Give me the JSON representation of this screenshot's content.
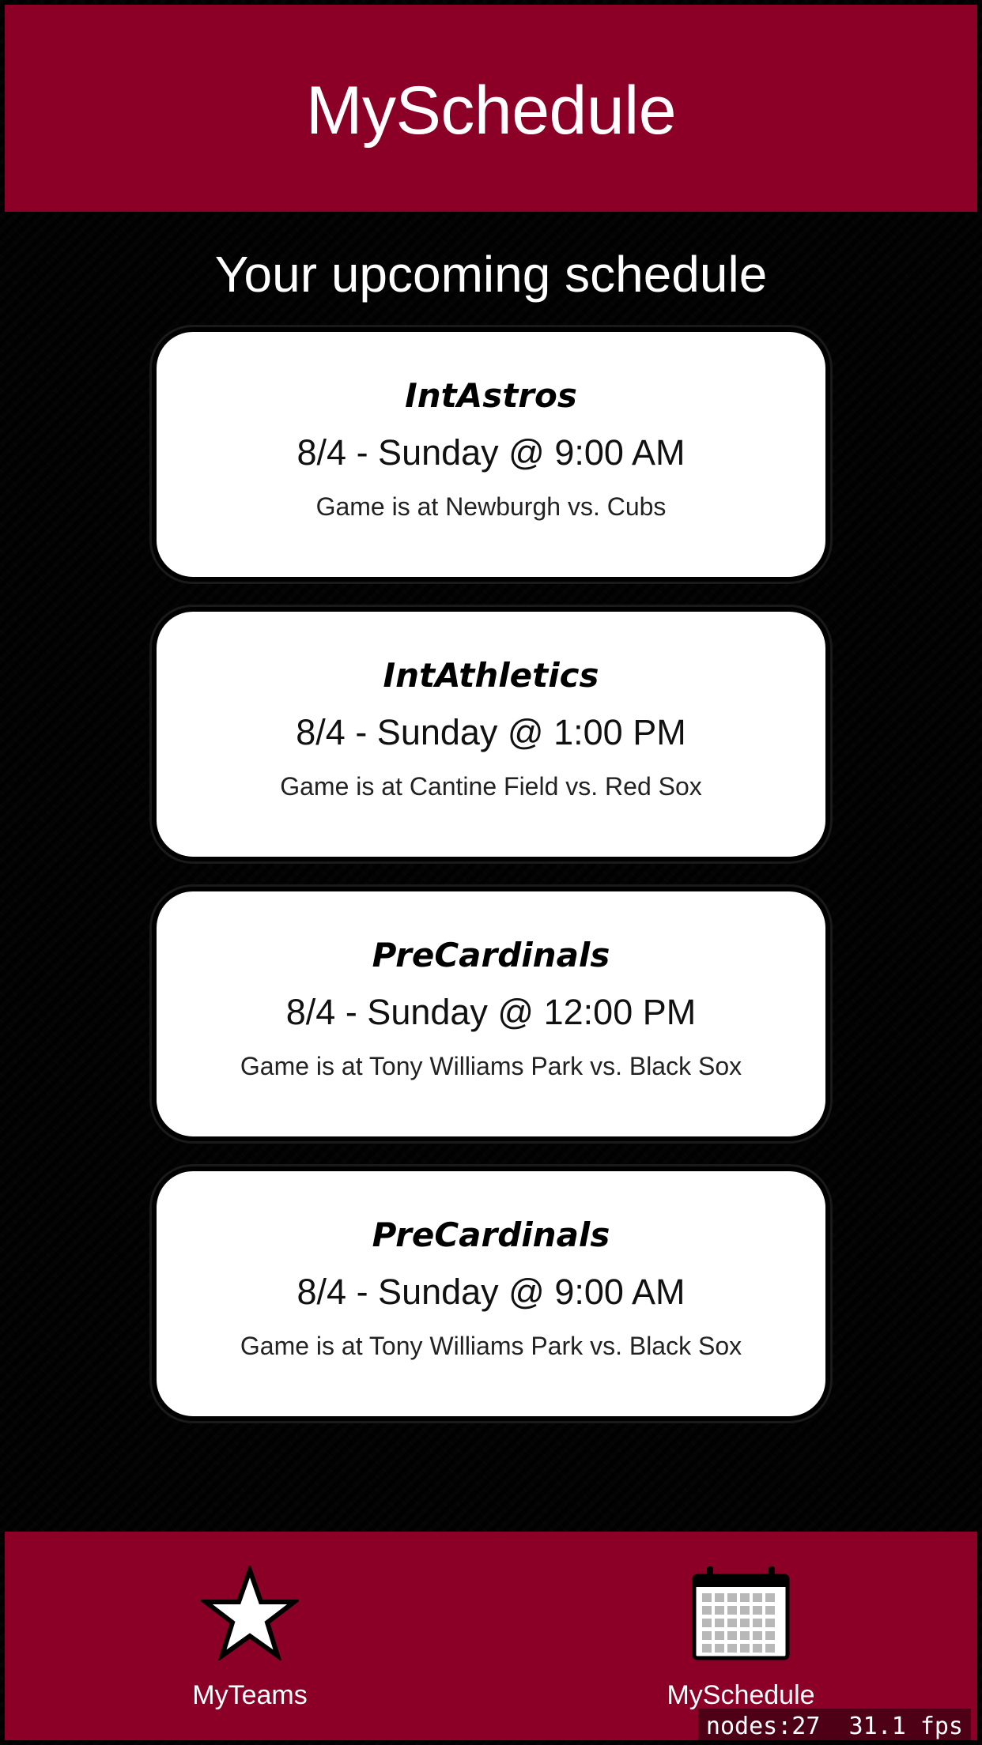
{
  "colors": {
    "brand": "#8c0028",
    "background": "#111111",
    "card": "#ffffff"
  },
  "header": {
    "title": "MySchedule"
  },
  "subtitle": "Your upcoming schedule",
  "games": [
    {
      "team": "IntAstros",
      "date": "8/4 - Sunday @ 9:00 AM",
      "location": "Game is at Newburgh vs. Cubs"
    },
    {
      "team": "IntAthletics",
      "date": "8/4 - Sunday @ 1:00 PM",
      "location": "Game is at Cantine Field vs. Red Sox"
    },
    {
      "team": "PreCardinals",
      "date": "8/4 - Sunday @ 12:00 PM",
      "location": "Game is at Tony Williams Park vs. Black Sox"
    },
    {
      "team": "PreCardinals",
      "date": "8/4 - Sunday @ 9:00 AM",
      "location": "Game is at Tony Williams Park vs. Black Sox"
    }
  ],
  "tabbar": {
    "tabs": [
      {
        "label": "MyTeams",
        "icon": "star-icon"
      },
      {
        "label": "MySchedule",
        "icon": "calendar-icon"
      }
    ]
  },
  "debug": {
    "text": "nodes:27  31.1 fps"
  }
}
